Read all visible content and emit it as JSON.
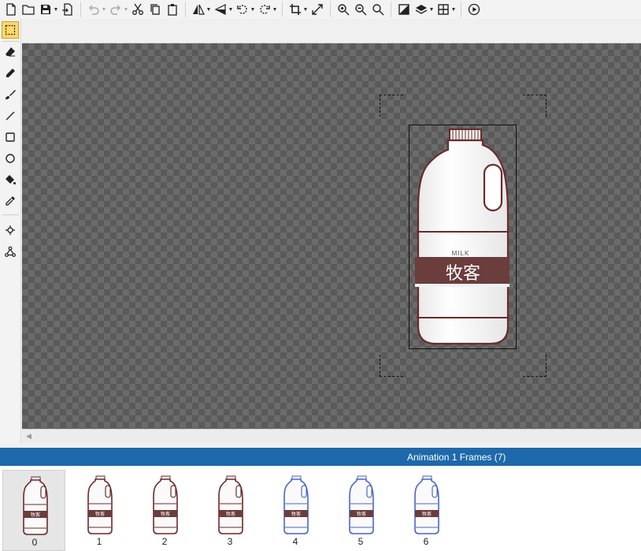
{
  "toolbar": {
    "icons": [
      "new-file-icon",
      "open-folder-icon",
      "save-icon",
      "export-icon",
      "undo-icon",
      "redo-icon",
      "cut-icon",
      "copy-icon",
      "paste-icon",
      "flip-horizontal-icon",
      "flip-vertical-icon",
      "rotate-left-icon",
      "rotate-right-icon",
      "crop-icon",
      "resize-icon",
      "zoom-in-icon",
      "zoom-out-icon",
      "zoom-reset-icon",
      "color-invert-icon",
      "layers-icon",
      "grid-icon",
      "play-icon"
    ]
  },
  "tools": {
    "items": [
      "marquee-select",
      "eraser",
      "pencil",
      "brush",
      "line",
      "rectangle",
      "ellipse",
      "fill-bucket",
      "eyedropper",
      "transform-point",
      "skeleton"
    ],
    "active": "marquee-select"
  },
  "canvas": {
    "bottle_label_small": "MILK",
    "bottle_label_main": "牧客"
  },
  "panel": {
    "title": "Animation 1 Frames (7)"
  },
  "frames": [
    {
      "index": "0",
      "selected": true,
      "outline": "#6b2a2a"
    },
    {
      "index": "1",
      "selected": false,
      "outline": "#6b2a2a"
    },
    {
      "index": "2",
      "selected": false,
      "outline": "#6b2a2a"
    },
    {
      "index": "3",
      "selected": false,
      "outline": "#6b2a2a"
    },
    {
      "index": "4",
      "selected": false,
      "outline": "#4a67c7"
    },
    {
      "index": "5",
      "selected": false,
      "outline": "#4a67c7"
    },
    {
      "index": "6",
      "selected": false,
      "outline": "#4a67c7"
    }
  ],
  "colors": {
    "accent": "#1e69ab",
    "label_band": "#6b3d3d",
    "active_tool": "#ffd86b"
  }
}
